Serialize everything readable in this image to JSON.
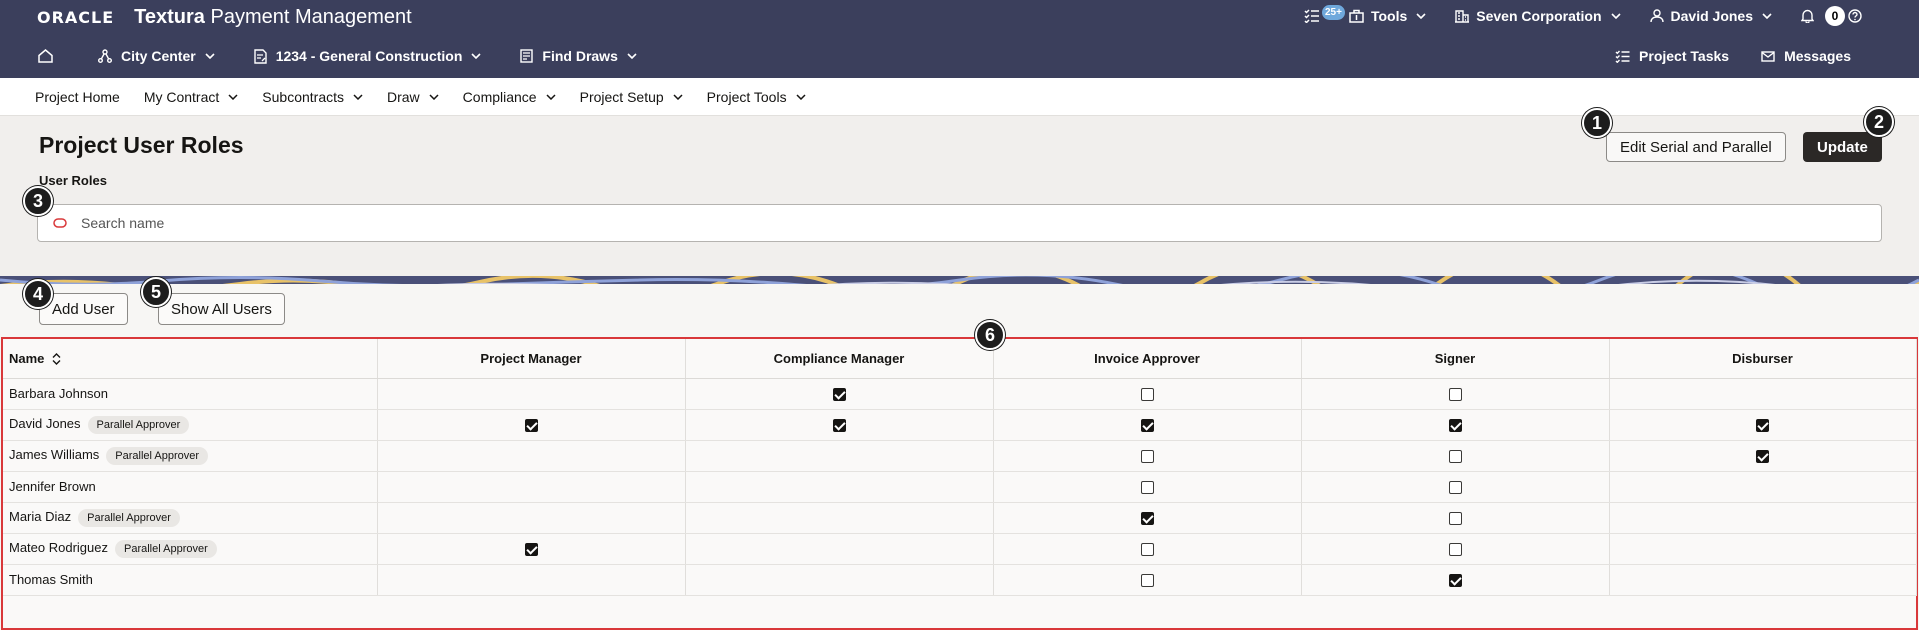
{
  "header": {
    "oracle": "ORACLE",
    "product_bold": "Textura",
    "product_rest": " Payment Management",
    "tasks_badge": "25+",
    "tools": "Tools",
    "organization": "Seven Corporation",
    "user": "David Jones",
    "notifications": "0"
  },
  "nav": {
    "project": "City Center",
    "contract": "1234 - General Construction",
    "find_draws": "Find Draws",
    "project_tasks": "Project Tasks",
    "messages": "Messages"
  },
  "menu": [
    "Project Home",
    "My Contract",
    "Subcontracts",
    "Draw",
    "Compliance",
    "Project Setup",
    "Project Tools"
  ],
  "page": {
    "title": "Project User Roles",
    "subtitle": "User Roles",
    "search_placeholder": "Search name",
    "edit_button": "Edit Serial and Parallel",
    "update_button": "Update",
    "add_user": "Add User",
    "show_all": "Show All Users"
  },
  "markers": [
    "1",
    "2",
    "3",
    "4",
    "5",
    "6"
  ],
  "table": {
    "name_header": "Name",
    "roles": [
      "Project Manager",
      "Compliance Manager",
      "Invoice Approver",
      "Signer",
      "Disburser"
    ],
    "rows": [
      {
        "name": "Barbara Johnson",
        "tag": "",
        "cells": [
          "",
          "checked",
          "unchecked",
          "unchecked",
          ""
        ]
      },
      {
        "name": "David Jones",
        "tag": "Parallel Approver",
        "cells": [
          "checked",
          "checked",
          "checked",
          "checked",
          "checked"
        ]
      },
      {
        "name": "James Williams",
        "tag": "Parallel Approver",
        "cells": [
          "",
          "",
          "unchecked",
          "unchecked",
          "checked"
        ]
      },
      {
        "name": "Jennifer Brown",
        "tag": "",
        "cells": [
          "",
          "",
          "unchecked",
          "unchecked",
          ""
        ]
      },
      {
        "name": "Maria Diaz",
        "tag": "Parallel Approver",
        "cells": [
          "",
          "",
          "checked",
          "unchecked",
          ""
        ]
      },
      {
        "name": "Mateo Rodriguez",
        "tag": "Parallel Approver",
        "cells": [
          "checked",
          "",
          "unchecked",
          "unchecked",
          ""
        ]
      },
      {
        "name": "Thomas Smith",
        "tag": "",
        "cells": [
          "",
          "",
          "unchecked",
          "checked",
          ""
        ]
      }
    ]
  },
  "colors": {
    "header_bg": "#3b3f5c",
    "title_bg": "#f1efed",
    "primary_button": "#2b2826",
    "highlight_border": "#d9383a",
    "badge": "#6fa8dc"
  }
}
